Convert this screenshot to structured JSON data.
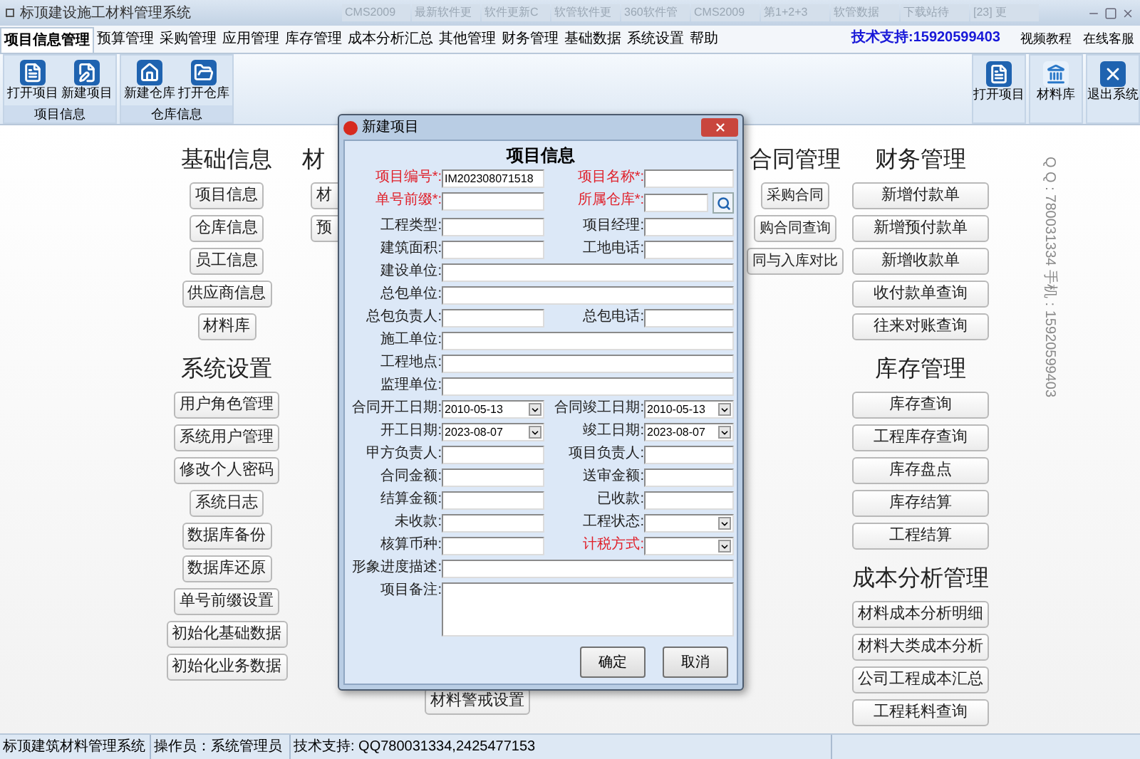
{
  "window": {
    "title": "标顶建设施工材料管理系统"
  },
  "background_tabs": [
    "CMS2009",
    "最新软件更",
    "软件更新C",
    "软管软件更",
    "360软件管",
    "CMS2009",
    "第1+2+3",
    "软管数据",
    "下载站待",
    "[23] 更"
  ],
  "menu": [
    {
      "label": "项目信息管理",
      "selected": true
    },
    {
      "label": "预算管理",
      "selected": false
    },
    {
      "label": "采购管理",
      "selected": false
    },
    {
      "label": "应用管理",
      "selected": false
    },
    {
      "label": "库存管理",
      "selected": false
    },
    {
      "label": "成本分析汇总",
      "selected": false
    },
    {
      "label": "其他管理",
      "selected": false
    },
    {
      "label": "财务管理",
      "selected": false
    },
    {
      "label": "基础数据",
      "selected": false
    },
    {
      "label": "系统设置",
      "selected": false
    },
    {
      "label": "帮助",
      "selected": false
    }
  ],
  "support": "技术支持:15920599403",
  "top_links": [
    "视频教程",
    "在线客服"
  ],
  "ribbon_groups": [
    {
      "label": "项目信息",
      "buttons": [
        {
          "label": "打开项目",
          "kind": "document"
        },
        {
          "label": "新建项目",
          "kind": "edit"
        }
      ]
    },
    {
      "label": "仓库信息",
      "buttons": [
        {
          "label": "新建仓库",
          "kind": "house"
        },
        {
          "label": "打开仓库",
          "kind": "folder"
        }
      ]
    }
  ],
  "ribbon_right": [
    {
      "label": "打开项目",
      "kind": "document"
    },
    {
      "label": "材料库",
      "kind": "bank"
    },
    {
      "label": "退出系统",
      "kind": "exit"
    }
  ],
  "columns": [
    {
      "sections": [
        {
          "title": "基础信息",
          "items": [
            "项目信息",
            "仓库信息",
            "员工信息",
            "供应商信息",
            "材料库"
          ]
        },
        {
          "title": "系统设置",
          "items": [
            "用户角色管理",
            "系统用户管理",
            "修改个人密码",
            "系统日志",
            "数据库备份",
            "数据库还原",
            "单号前缀设置",
            "初始化基础数据",
            "初始化业务数据"
          ]
        }
      ]
    },
    {
      "sections": [
        {
          "title": "材",
          "items": [
            "材",
            "预"
          ]
        }
      ],
      "footer": "材料警戒设置"
    },
    {
      "sections": [
        {
          "title": "合同管理",
          "items": [
            "采购合同",
            "购合同查询",
            "同与入库对比"
          ]
        }
      ]
    },
    {
      "sections": [
        {
          "title": "财务管理",
          "items": [
            "新增付款单",
            "新增预付款单",
            "新增收款单",
            "收付款单查询",
            "往来对账查询"
          ]
        },
        {
          "title": "库存管理",
          "items": [
            "库存查询",
            "工程库存查询",
            "库存盘点",
            "库存结算",
            "工程结算"
          ]
        },
        {
          "title": "成本分析管理",
          "items": [
            "材料成本分析明细",
            "材料大类成本分析",
            "公司工程成本汇总",
            "工程耗料查询"
          ]
        }
      ]
    }
  ],
  "contact": "Q Q : 780031334   手机 : 15920599403",
  "dialog": {
    "title": "新建项目",
    "heading": "项目信息",
    "rows": [
      [
        {
          "label": "项目编号*:",
          "required": true,
          "kind": "text",
          "value": "IM202308071518"
        },
        {
          "label": "项目名称*:",
          "required": true,
          "kind": "text"
        }
      ],
      [
        {
          "label": "单号前缀*:",
          "required": true,
          "kind": "text"
        },
        {
          "label": "所属仓库*:",
          "required": true,
          "kind": "lookup"
        }
      ],
      [
        {
          "label": "工程类型:",
          "required": false,
          "kind": "text"
        },
        {
          "label": "项目经理:",
          "required": false,
          "kind": "text"
        }
      ],
      [
        {
          "label": "建筑面积:",
          "required": false,
          "kind": "text"
        },
        {
          "label": "工地电话:",
          "required": false,
          "kind": "text"
        }
      ],
      [
        {
          "label": "建设单位:",
          "required": false,
          "kind": "text"
        }
      ],
      [
        {
          "label": "总包单位:",
          "required": false,
          "kind": "text"
        }
      ],
      [
        {
          "label": "总包负责人:",
          "required": false,
          "kind": "text"
        },
        {
          "label": "总包电话:",
          "required": false,
          "kind": "text"
        }
      ],
      [
        {
          "label": "施工单位:",
          "required": false,
          "kind": "text"
        }
      ],
      [
        {
          "label": "工程地点:",
          "required": false,
          "kind": "text"
        }
      ],
      [
        {
          "label": "监理单位:",
          "required": false,
          "kind": "text"
        }
      ],
      [
        {
          "label": "合同开工日期:",
          "required": false,
          "kind": "select",
          "value": "2010-05-13"
        },
        {
          "label": "合同竣工日期:",
          "required": false,
          "kind": "select",
          "value": "2010-05-13"
        }
      ],
      [
        {
          "label": "开工日期:",
          "required": false,
          "kind": "select",
          "value": "2023-08-07"
        },
        {
          "label": "竣工日期:",
          "required": false,
          "kind": "select",
          "value": "2023-08-07"
        }
      ],
      [
        {
          "label": "甲方负责人:",
          "required": false,
          "kind": "text"
        },
        {
          "label": "项目负责人:",
          "required": false,
          "kind": "text"
        }
      ],
      [
        {
          "label": "合同金额:",
          "required": false,
          "kind": "text"
        },
        {
          "label": "送审金额:",
          "required": false,
          "kind": "text"
        }
      ],
      [
        {
          "label": "结算金额:",
          "required": false,
          "kind": "text"
        },
        {
          "label": "已收款:",
          "required": false,
          "kind": "text"
        }
      ],
      [
        {
          "label": "未收款:",
          "required": false,
          "kind": "text"
        },
        {
          "label": "工程状态:",
          "required": false,
          "kind": "select"
        }
      ],
      [
        {
          "label": "核算币种:",
          "required": false,
          "kind": "text"
        },
        {
          "label": "计税方式:",
          "required": true,
          "kind": "select"
        }
      ],
      [
        {
          "label": "形象进度描述:",
          "required": false,
          "kind": "text"
        }
      ],
      [
        {
          "label": "项目备注:",
          "required": false,
          "kind": "textarea"
        }
      ]
    ],
    "buttons": [
      "确定",
      "取消"
    ]
  },
  "status_bar": [
    "标顶建筑材料管理系统",
    "操作员：系统管理员",
    "技术支持: QQ780031334,2425477153"
  ]
}
